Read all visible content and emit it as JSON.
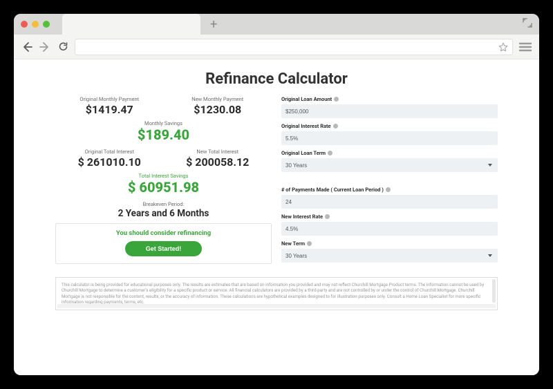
{
  "page": {
    "title": "Refinance Calculator"
  },
  "results": {
    "orig_monthly_label": "Original Monthly Payment",
    "orig_monthly_value": "$1419.47",
    "new_monthly_label": "New Monthly Payment",
    "new_monthly_value": "$1230.08",
    "monthly_savings_label": "Monthly Savings",
    "monthly_savings_value": "$189.40",
    "orig_total_interest_label": "Original Total Interest",
    "orig_total_interest_value": "$ 261010.10",
    "new_total_interest_label": "New Total Interest",
    "new_total_interest_value": "$ 200058.12",
    "total_interest_savings_label": "Total Interest Savings",
    "total_interest_savings_value": "$ 60951.98",
    "breakeven_label": "Breakeven Period:",
    "breakeven_value": "2 Years and 6 Months",
    "recommend_text": "You should consider refinancing",
    "cta_label": "Get Started!"
  },
  "inputs": {
    "orig_amount_label": "Original Loan Amount",
    "orig_amount_value": "$250,000",
    "orig_rate_label": "Original Interest Rate",
    "orig_rate_value": "5.5%",
    "orig_term_label": "Original Loan Term",
    "orig_term_value": "30 Years",
    "payments_made_label": "# of Payments Made ( Current Loan Period )",
    "payments_made_value": "24",
    "new_rate_label": "New Interest Rate",
    "new_rate_value": "4.5%",
    "new_term_label": "New Term",
    "new_term_value": "30 Years"
  },
  "disclaimer": "This calculator is being provided for educational purposes only. The results are estimates that are based on information you provided and may not reflect Churchill Mortgage Product terms. The information cannot be used by Churchill Mortgage to determine a customer's eligibility for a specific product or service. All financial calculators are provided by a third-party and are not controlled by or under the control of Churchill Mortgage. Churchill Mortgage is not responsible for the content, results, or the accuracy of information. These calculations are hypothetical examples designed to for illustration purposes only. Consult a Home Loan Specialist for more specific information regarding payments, terms, etc."
}
